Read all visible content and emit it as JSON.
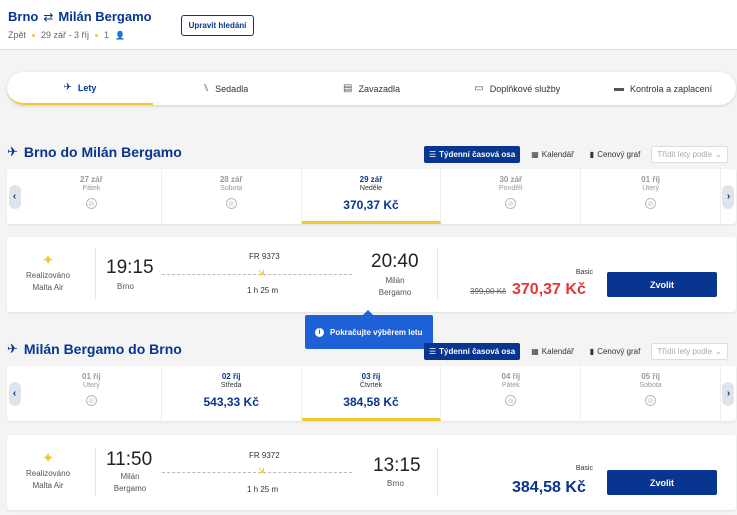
{
  "header": {
    "origin": "Brno",
    "destination": "Milán Bergamo",
    "trip_type": "Zpět",
    "dates": "29 zář - 3 říj",
    "passengers": "1",
    "edit_label": "Upravit hledání"
  },
  "steps": [
    {
      "label": "Lety",
      "icon": "plane-icon"
    },
    {
      "label": "Sedadla",
      "icon": "seat-icon"
    },
    {
      "label": "Zavazadla",
      "icon": "luggage-icon"
    },
    {
      "label": "Doplňkové služby",
      "icon": "monitor-icon"
    },
    {
      "label": "Kontrola a zaplacení",
      "icon": "card-icon"
    }
  ],
  "views": {
    "timeline": "Týdenní časová osa",
    "calendar": "Kalendář",
    "price_graph": "Cenový graf",
    "sort": "Třídit lety podle"
  },
  "outbound": {
    "title": "Brno do Milán Bergamo",
    "dates": [
      {
        "date": "27 zář",
        "weekday": "Pátek",
        "price": ""
      },
      {
        "date": "28 zář",
        "weekday": "Sobota",
        "price": ""
      },
      {
        "date": "29 zář",
        "weekday": "Neděle",
        "price": "370,37 Kč"
      },
      {
        "date": "30 zář",
        "weekday": "Pondělí",
        "price": ""
      },
      {
        "date": "01 říj",
        "weekday": "Úterý",
        "price": ""
      }
    ],
    "flight": {
      "operated_by": "Realizováno",
      "airline": "Malta Air",
      "dep_time": "19:15",
      "dep_place": "Brno",
      "flight_no": "FR 9373",
      "duration": "1 h 25 m",
      "arr_time": "20:40",
      "arr_place_1": "Milán",
      "arr_place_2": "Bergamo",
      "fare": "Basic",
      "old_price": "399,00 Kč",
      "price": "370,37 Kč",
      "choose": "Zvolit"
    }
  },
  "inbound": {
    "title": "Milán Bergamo do Brno",
    "dates": [
      {
        "date": "01 říj",
        "weekday": "Úterý",
        "price": ""
      },
      {
        "date": "02 říj",
        "weekday": "Středa",
        "price": "543,33 Kč"
      },
      {
        "date": "03 říj",
        "weekday": "Čtvrtek",
        "price": "384,58 Kč"
      },
      {
        "date": "04 říj",
        "weekday": "Pátek",
        "price": ""
      },
      {
        "date": "05 říj",
        "weekday": "Sobota",
        "price": ""
      }
    ],
    "flight": {
      "operated_by": "Realizováno",
      "airline": "Malta Air",
      "dep_time": "11:50",
      "dep_place_1": "Milán",
      "dep_place_2": "Bergamo",
      "flight_no": "FR 9372",
      "duration": "1 h 25 m",
      "arr_time": "13:15",
      "arr_place": "Brno",
      "fare": "Basic",
      "price": "384,58 Kč",
      "choose": "Zvolit"
    }
  },
  "tooltip": "Pokračujte výběrem letu",
  "colors": {
    "brand": "#073590",
    "accent": "#f1c933",
    "sale": "#e3353a",
    "tooltip": "#1e61d6"
  }
}
